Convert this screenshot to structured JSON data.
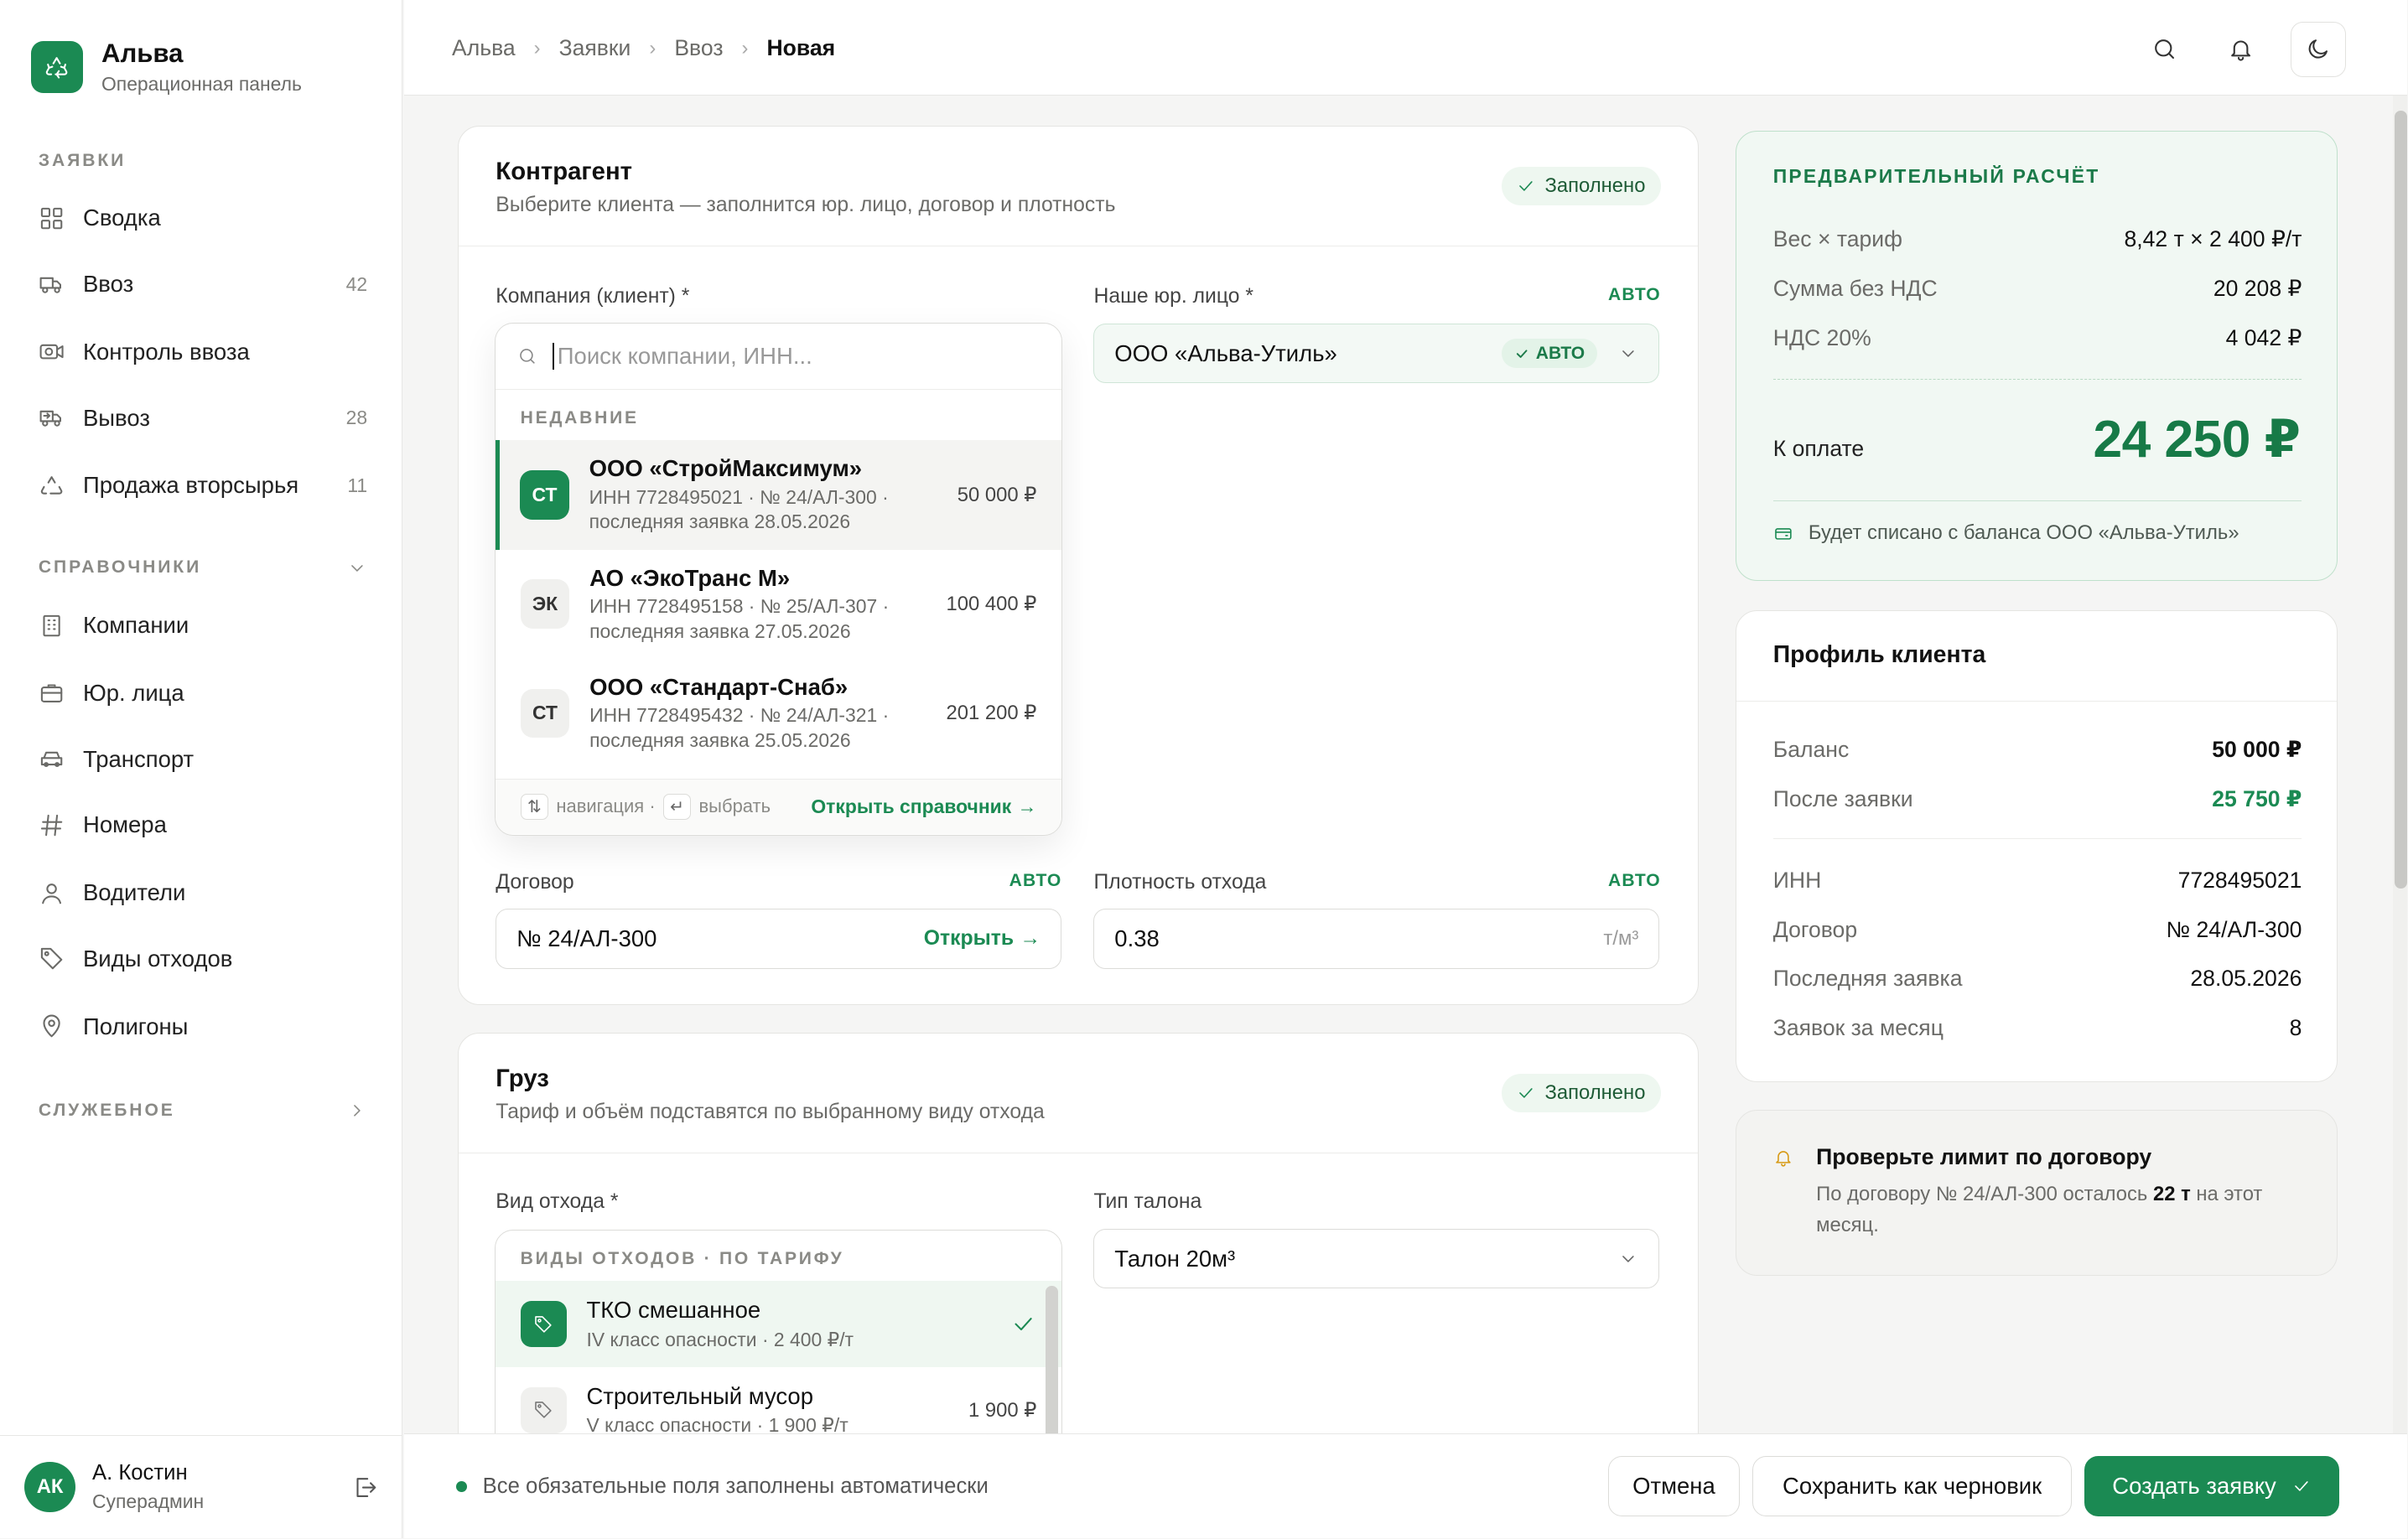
{
  "brand": {
    "title": "Альва",
    "subtitle": "Операционная панель"
  },
  "sidebar": {
    "sections": [
      {
        "label": "ЗАЯВКИ"
      },
      {
        "label": "СПРАВОЧНИКИ"
      },
      {
        "label": "СЛУЖЕБНОЕ"
      }
    ],
    "items": [
      {
        "label": "Сводка",
        "count": "",
        "icon": "grid-icon"
      },
      {
        "label": "Ввоз",
        "count": "42",
        "icon": "truck-in-icon"
      },
      {
        "label": "Контроль ввоза",
        "count": "",
        "icon": "camera-icon"
      },
      {
        "label": "Вывоз",
        "count": "28",
        "icon": "truck-out-icon"
      },
      {
        "label": "Продажа вторсырья",
        "count": "11",
        "icon": "recycle-icon"
      },
      {
        "label": "Компании",
        "count": "",
        "icon": "building-icon"
      },
      {
        "label": "Юр. лица",
        "count": "",
        "icon": "briefcase-icon"
      },
      {
        "label": "Транспорт",
        "count": "",
        "icon": "car-icon"
      },
      {
        "label": "Номера",
        "count": "",
        "icon": "hash-icon"
      },
      {
        "label": "Водители",
        "count": "",
        "icon": "user-icon"
      },
      {
        "label": "Виды отходов",
        "count": "",
        "icon": "tag-icon"
      },
      {
        "label": "Полигоны",
        "count": "",
        "icon": "map-pin-icon"
      }
    ]
  },
  "user": {
    "initials": "АК",
    "name": "А. Костин",
    "role": "Суперадмин"
  },
  "breadcrumbs": [
    "Альва",
    "Ввоз",
    "Новая"
  ],
  "crumb_root": "Альва",
  "crumb_1": "Заявки",
  "crumb_2": "Ввоз",
  "crumb_current": "Новая",
  "counterparty": {
    "title": "Контрагент",
    "subtitle": "Выберите клиента — заполнится юр. лицо, договор и плотность",
    "status": "Заполнено",
    "company_label": "Компания (клиент) *",
    "search_placeholder": "Поиск компании, ИНН...",
    "recent_label": "НЕДАВНИЕ",
    "options": [
      {
        "initials": "СТ",
        "name": "ООО «СтройМаксимум»",
        "meta": "ИНН 7728495021 · № 24/АЛ-300 · последняя заявка 28.05.2026",
        "amount": "50 000 ₽"
      },
      {
        "initials": "ЭК",
        "name": "АО «ЭкоТранс М»",
        "meta": "ИНН 7728495158 · № 25/АЛ-307 · последняя заявка 27.05.2026",
        "amount": "100 400 ₽"
      },
      {
        "initials": "СТ",
        "name": "ООО «Стандарт-Снаб»",
        "meta": "ИНН 7728495432 · № 24/АЛ-321 · последняя заявка 25.05.2026",
        "amount": "201 200 ₽"
      }
    ],
    "footer_nav": "навигация ·",
    "footer_pick": "выбрать",
    "footer_link": "Открыть справочник",
    "legal_label": "Наше юр. лицо *",
    "legal_auto": "АВТО",
    "legal_value": "ООО «Альва-Утиль»",
    "legal_chip": "АВТО",
    "contract_label": "Договор",
    "contract_auto": "АВТО",
    "contract_value": "№ 24/АЛ-300",
    "contract_link": "Открыть",
    "density_label": "Плотность отхода",
    "density_auto": "АВТО",
    "density_value": "0.38",
    "density_unit": "т/м³"
  },
  "cargo": {
    "title": "Груз",
    "subtitle": "Тариф и объём подставятся по выбранному виду отхода",
    "status": "Заполнено",
    "waste_label": "Вид отхода *",
    "waste_section": "ВИДЫ ОТХОДОВ · ПО ТАРИФУ",
    "waste_options": [
      {
        "name": "ТКО смешанное",
        "meta": "IV класс опасности · 2 400 ₽/т",
        "amount": ""
      },
      {
        "name": "Строительный мусор",
        "meta": "V класс опасности · 1 900 ₽/т",
        "amount": "1 900 ₽"
      }
    ],
    "ticket_label": "Тип талона",
    "ticket_value": "Талон 20м³"
  },
  "calc": {
    "title": "ПРЕДВАРИТЕЛЬНЫЙ РАСЧЁТ",
    "rows": [
      {
        "k": "Вес × тариф",
        "v": "8,42 т × 2 400 ₽/т"
      },
      {
        "k": "Сумма без НДС",
        "v": "20 208 ₽"
      },
      {
        "k": "НДС 20%",
        "v": "4 042 ₽"
      }
    ],
    "total_label": "К оплате",
    "total_value": "24 250 ₽",
    "note": "Будет списано с баланса ООО «Альва-Утиль»"
  },
  "profile": {
    "title": "Профиль клиента",
    "balance_label": "Баланс",
    "balance_value": "50 000 ₽",
    "after_label": "После заявки",
    "after_value": "25 750 ₽",
    "rows": [
      {
        "k": "ИНН",
        "v": "7728495021"
      },
      {
        "k": "Договор",
        "v": "№ 24/АЛ-300"
      },
      {
        "k": "Последняя заявка",
        "v": "28.05.2026"
      },
      {
        "k": "Заявок за месяц",
        "v": "8"
      }
    ]
  },
  "warning": {
    "title": "Проверьте лимит по договору",
    "text_before": "По договору № 24/АЛ-300 осталось",
    "text_bold": "22 т",
    "text_after": "на этот месяц."
  },
  "footer": {
    "status": "Все обязательные поля заполнены автоматически",
    "cancel": "Отмена",
    "draft": "Сохранить как черновик",
    "create": "Создать заявку"
  },
  "colors": {
    "accent": "#1b8a53",
    "accent_light": "#f1f8f3",
    "warning": "#d79a16"
  }
}
